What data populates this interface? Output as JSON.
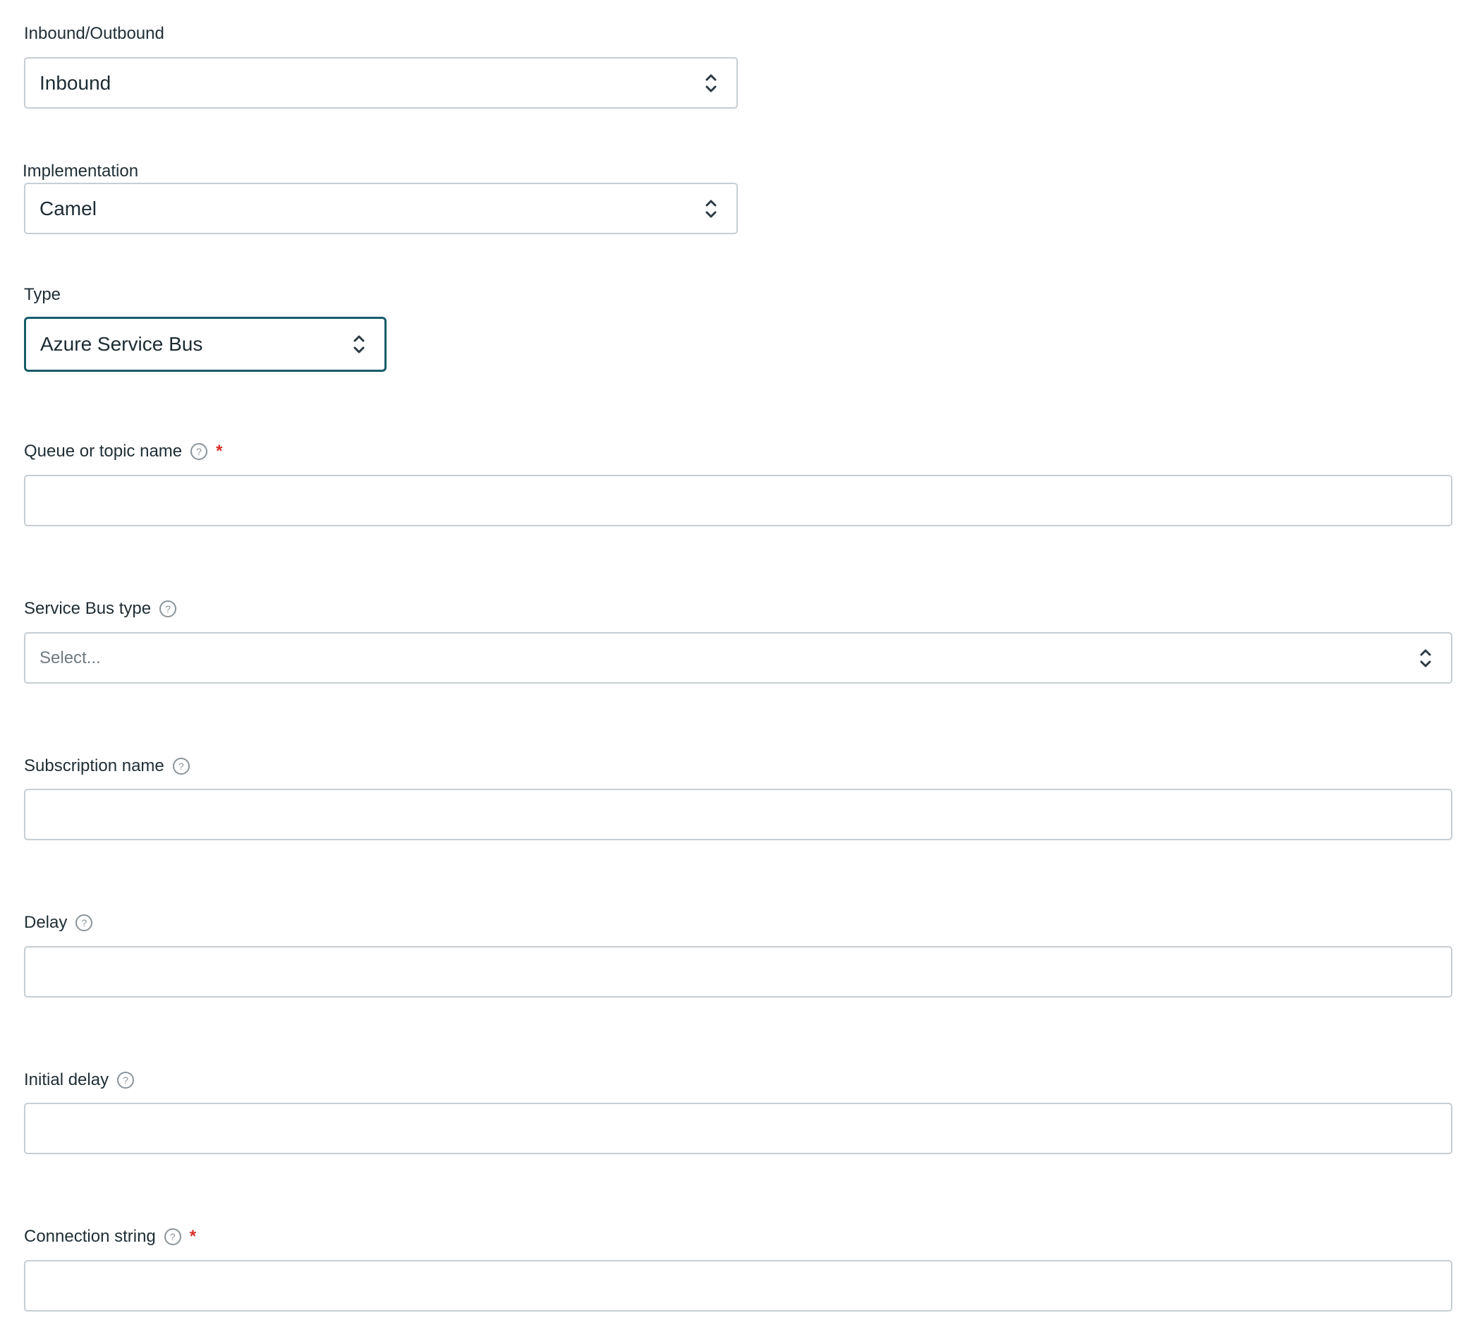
{
  "fields": {
    "direction": {
      "label": "Inbound/Outbound",
      "value": "Inbound"
    },
    "implementation": {
      "label": "Implementation",
      "value": "Camel"
    },
    "type": {
      "label": "Type",
      "value": "Azure Service Bus"
    },
    "queue_name": {
      "label": "Queue or topic name",
      "help": "?",
      "required": "*",
      "value": ""
    },
    "service_bus_type": {
      "label": "Service Bus type",
      "help": "?",
      "placeholder": "Select..."
    },
    "subscription_name": {
      "label": "Subscription name",
      "help": "?",
      "value": ""
    },
    "delay": {
      "label": "Delay",
      "help": "?",
      "value": ""
    },
    "initial_delay": {
      "label": "Initial delay",
      "help": "?",
      "value": ""
    },
    "connection_string": {
      "label": "Connection string",
      "help": "?",
      "required": "*",
      "value": ""
    }
  },
  "icons": {
    "select_chevron": "chevron-up-down-icon",
    "help": "question-circle-icon"
  },
  "colors": {
    "focus_border": "#175c6b",
    "border": "#c6ced3",
    "required": "#d6302a",
    "text": "#1c2b33",
    "placeholder": "#6f7a80"
  }
}
